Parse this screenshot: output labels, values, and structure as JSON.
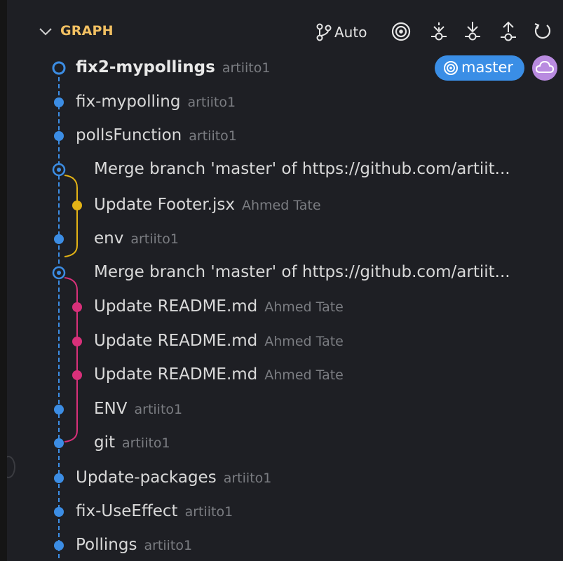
{
  "header": {
    "title": "GRAPH",
    "auto_label": "Auto",
    "icons": [
      "chevron-down-icon",
      "source-branch-icon",
      "target-icon",
      "fetch-icon",
      "pull-icon",
      "push-icon",
      "refresh-icon"
    ]
  },
  "badges": {
    "branch_label": "master",
    "branch_color": "#3a8ee6",
    "cloud_color": "#b98be0"
  },
  "colors": {
    "main_line": "#3c8de4",
    "merge_line_1": "#e3b316",
    "merge_line_2": "#d8307a",
    "title": "#f2c062"
  },
  "commits": [
    {
      "message": "fix2-mypollings",
      "author": "artiito1"
    },
    {
      "message": "fix-mypolling",
      "author": "artiito1"
    },
    {
      "message": "pollsFunction",
      "author": "artiito1"
    },
    {
      "message": "Merge branch 'master' of https://github.com/artiit...",
      "author": ""
    },
    {
      "message": "Update Footer.jsx",
      "author": "Ahmed Tate"
    },
    {
      "message": "env",
      "author": "artiito1"
    },
    {
      "message": "Merge branch 'master' of https://github.com/artiit...",
      "author": ""
    },
    {
      "message": "Update README.md",
      "author": "Ahmed Tate"
    },
    {
      "message": "Update README.md",
      "author": "Ahmed Tate"
    },
    {
      "message": "Update README.md",
      "author": "Ahmed Tate"
    },
    {
      "message": "ENV",
      "author": "artiito1"
    },
    {
      "message": "git",
      "author": "artiito1"
    },
    {
      "message": "Update-packages",
      "author": "artiito1"
    },
    {
      "message": "fix-UseEffect",
      "author": "artiito1"
    },
    {
      "message": "Pollings",
      "author": "artiito1"
    }
  ]
}
